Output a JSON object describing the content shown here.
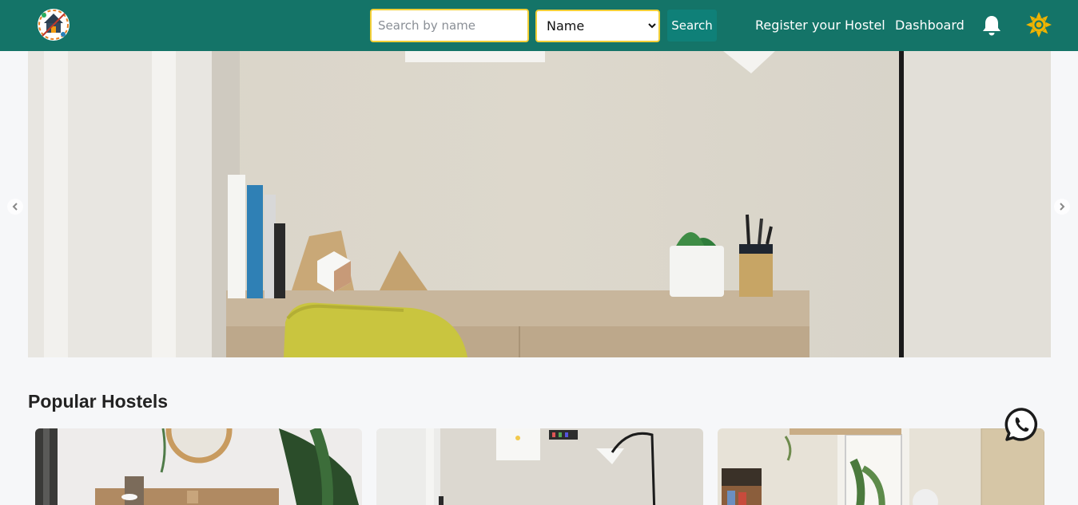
{
  "navbar": {
    "search_placeholder": "Search by name",
    "filter_selected": "Name",
    "search_button": "Search",
    "register_link": "Register your Hostel",
    "dashboard_link": "Dashboard",
    "icons": [
      "logo",
      "bell-icon",
      "sun-icon"
    ]
  },
  "hero": {
    "arrows": [
      "chevron-left-icon",
      "chevron-right-icon"
    ]
  },
  "popular": {
    "title": "Popular Hostels"
  },
  "colors": {
    "navbar": "#147468",
    "accent_border": "#f2cf37",
    "search_button": "#0f8078",
    "sun": "#f0b400",
    "background": "#f6f7f9"
  }
}
